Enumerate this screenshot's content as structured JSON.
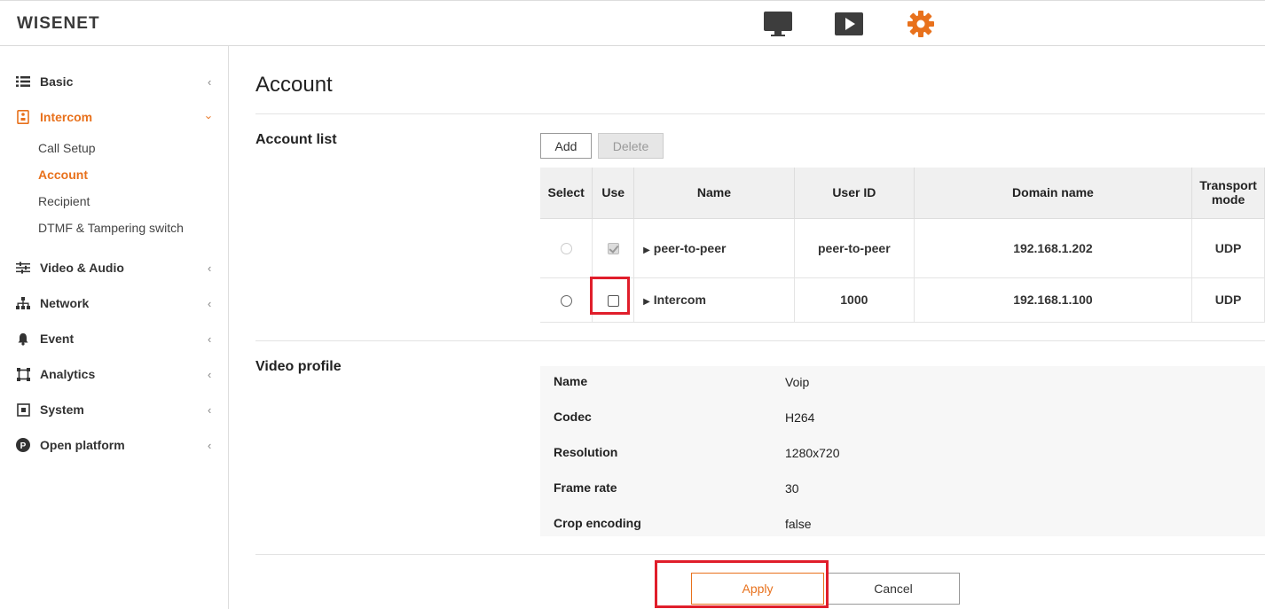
{
  "header": {
    "logo": "WISENET",
    "icons": [
      "monitor-icon",
      "play-icon",
      "gear-icon"
    ],
    "accent_color": "#e8711c"
  },
  "sidebar": {
    "items": [
      {
        "label": "Basic",
        "icon": "list-icon"
      },
      {
        "label": "Intercom",
        "icon": "intercom-icon",
        "active": true
      },
      {
        "label": "Video & Audio",
        "icon": "sliders-icon"
      },
      {
        "label": "Network",
        "icon": "network-icon"
      },
      {
        "label": "Event",
        "icon": "bell-icon"
      },
      {
        "label": "Analytics",
        "icon": "analytics-icon"
      },
      {
        "label": "System",
        "icon": "system-icon"
      },
      {
        "label": "Open platform",
        "icon": "platform-icon"
      }
    ],
    "sub_items": [
      "Call Setup",
      "Account",
      "Recipient",
      "DTMF & Tampering switch"
    ],
    "active_sub": "Account"
  },
  "main": {
    "title": "Account",
    "account_list": {
      "label": "Account list",
      "add_label": "Add",
      "delete_label": "Delete",
      "headers": [
        "Select",
        "Use",
        "Name",
        "User ID",
        "Domain name",
        "Transport mode"
      ],
      "rows": [
        {
          "name": "peer-to-peer",
          "user_id": "peer-to-peer",
          "domain": "192.168.1.202",
          "transport": "UDP",
          "select_disabled": true,
          "use_checked": true,
          "use_disabled": true
        },
        {
          "name": "Intercom",
          "user_id": "1000",
          "domain": "192.168.1.100",
          "transport": "UDP",
          "select_disabled": false,
          "use_checked": false,
          "use_disabled": false
        }
      ]
    },
    "video_profile": {
      "label": "Video profile",
      "fields": [
        {
          "label": "Name",
          "value": "Voip"
        },
        {
          "label": "Codec",
          "value": "H264"
        },
        {
          "label": "Resolution",
          "value": "1280x720"
        },
        {
          "label": "Frame rate",
          "value": "30"
        },
        {
          "label": "Crop encoding",
          "value": "false"
        }
      ]
    },
    "apply_label": "Apply",
    "cancel_label": "Cancel"
  }
}
